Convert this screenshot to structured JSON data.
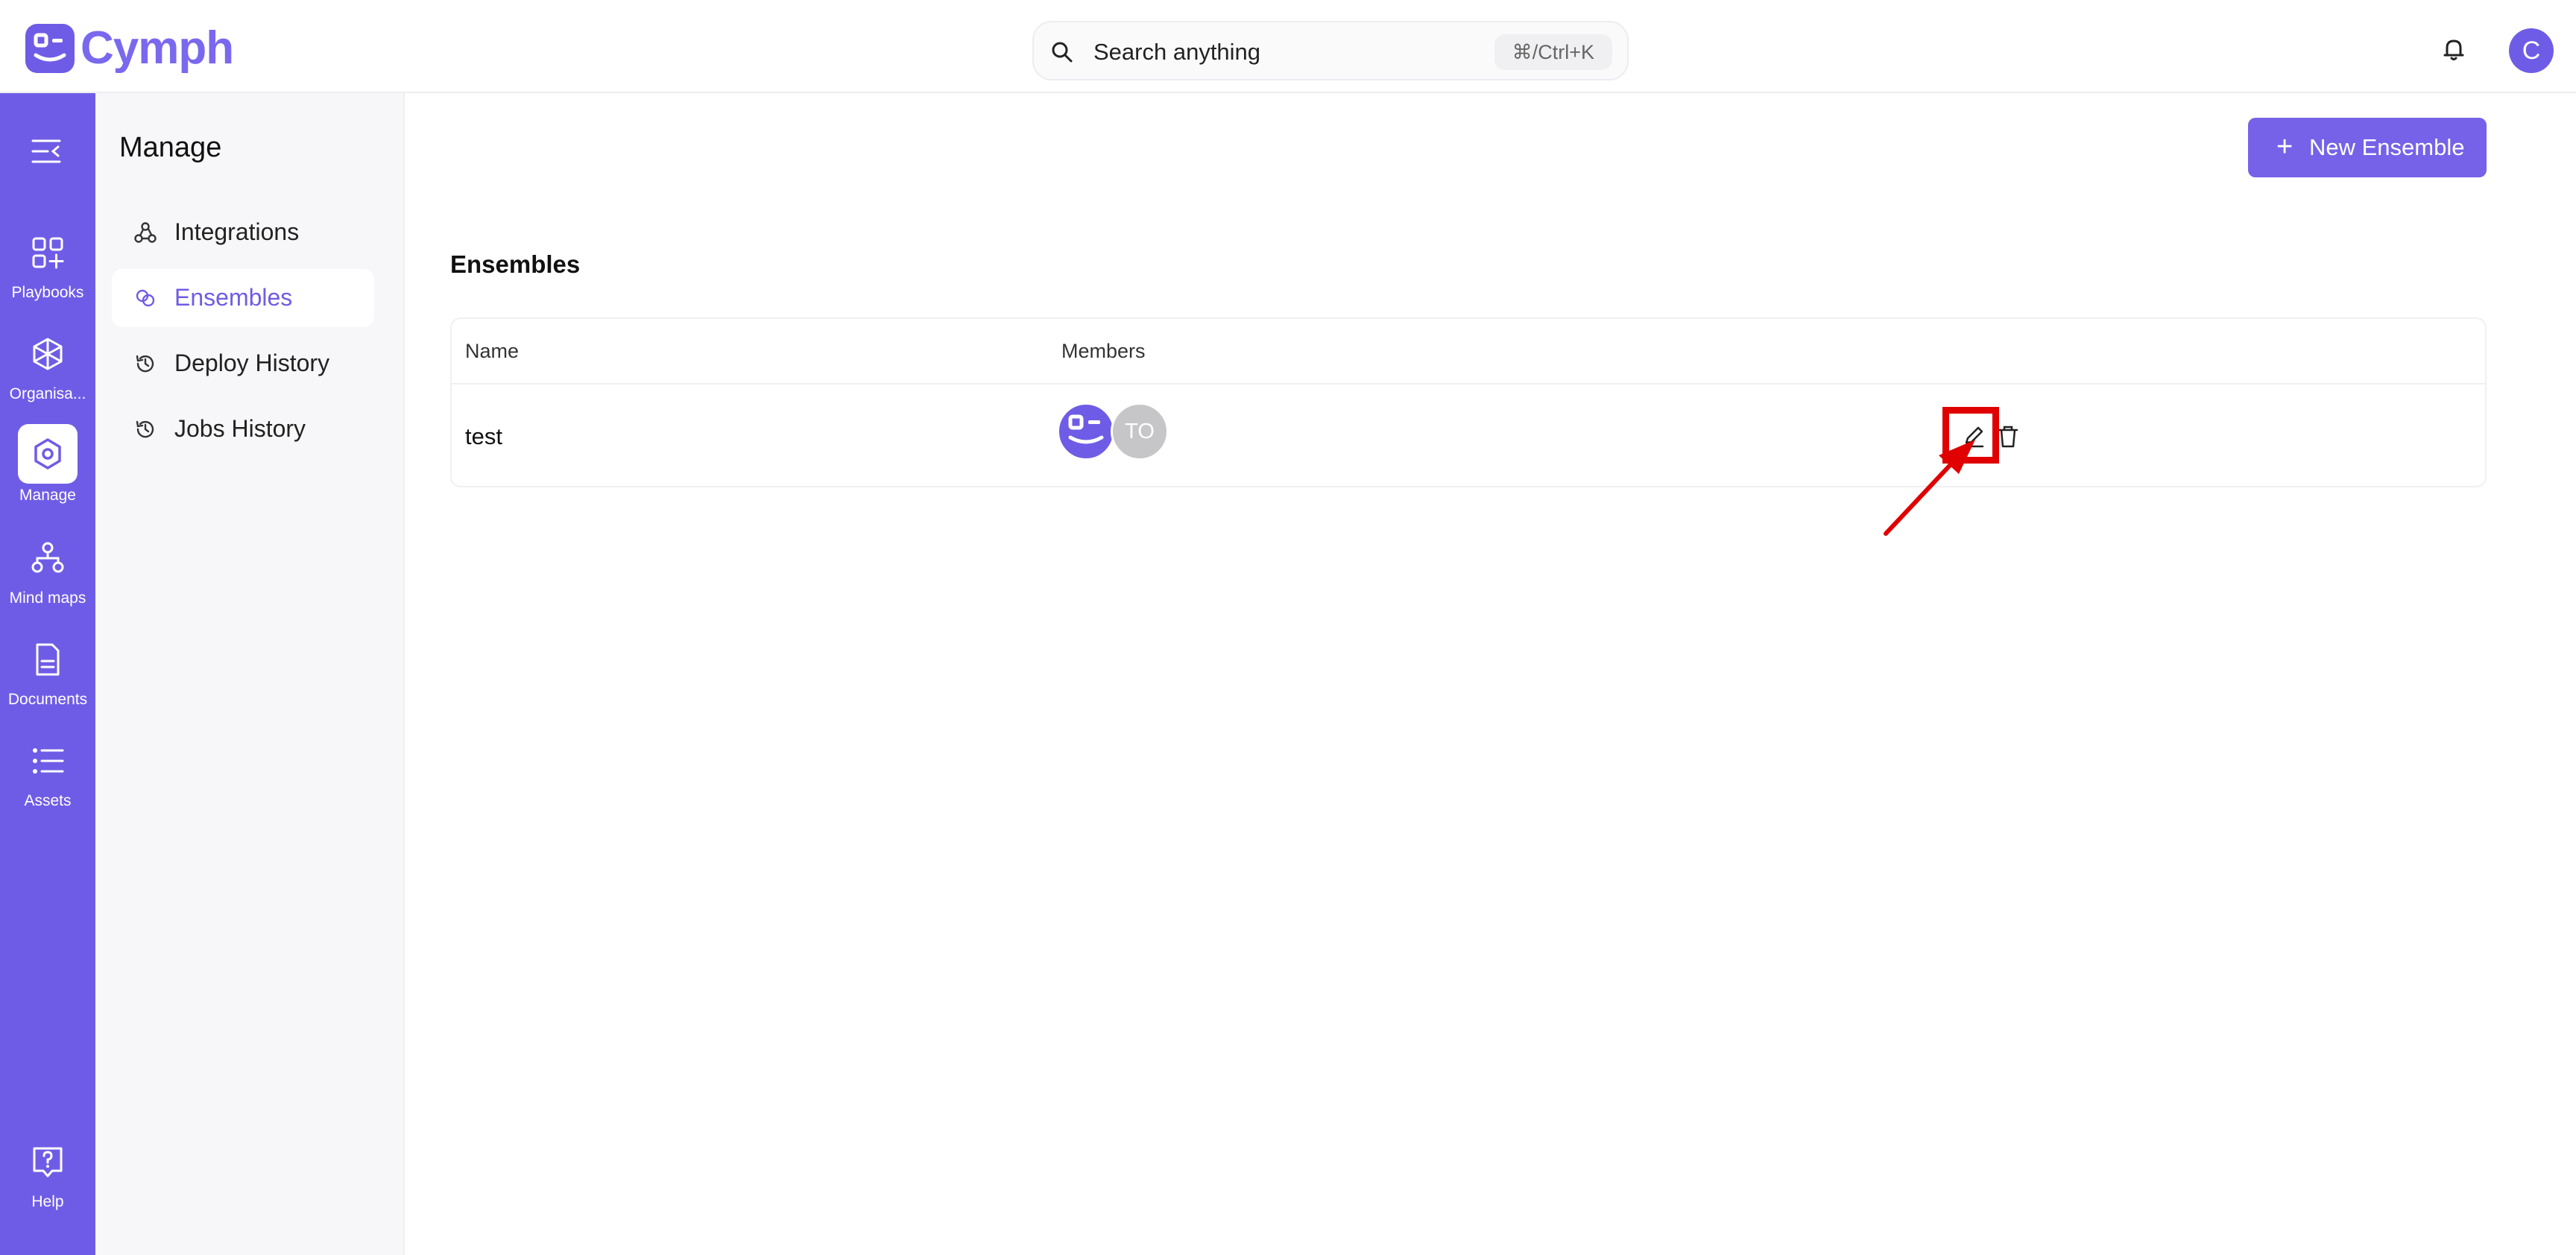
{
  "app": {
    "brand_name": "Cymph",
    "colors": {
      "accent": "#6f5ce6",
      "annotation": "#e00000",
      "surface": "#f7f7f9"
    }
  },
  "header": {
    "search_placeholder": "Search anything",
    "shortcut": "⌘/Ctrl+K",
    "user_initial": "C",
    "icons": [
      "logo-icon",
      "search-icon",
      "bell-icon"
    ]
  },
  "rail": {
    "items": [
      {
        "label": "Playbooks",
        "icon": "grid-plus-icon"
      },
      {
        "label": "Organisa...",
        "icon": "cube-icon"
      },
      {
        "label": "Manage",
        "icon": "hexagon-icon",
        "active": true
      },
      {
        "label": "Mind maps",
        "icon": "mind-map-icon"
      },
      {
        "label": "Documents",
        "icon": "document-icon"
      },
      {
        "label": "Assets",
        "icon": "list-icon"
      }
    ],
    "help_label": "Help"
  },
  "subnav": {
    "title": "Manage",
    "items": [
      {
        "label": "Integrations",
        "icon": "webhook-icon"
      },
      {
        "label": "Ensembles",
        "icon": "link-icon",
        "active": true
      },
      {
        "label": "Deploy History",
        "icon": "history-icon"
      },
      {
        "label": "Jobs History",
        "icon": "history-icon"
      }
    ]
  },
  "main": {
    "new_button_label": "New Ensemble",
    "title": "Ensembles",
    "table": {
      "columns": [
        "Name",
        "Members"
      ],
      "rows": [
        {
          "name": "test",
          "members": [
            "logo-avatar",
            "TO"
          ]
        }
      ]
    }
  }
}
